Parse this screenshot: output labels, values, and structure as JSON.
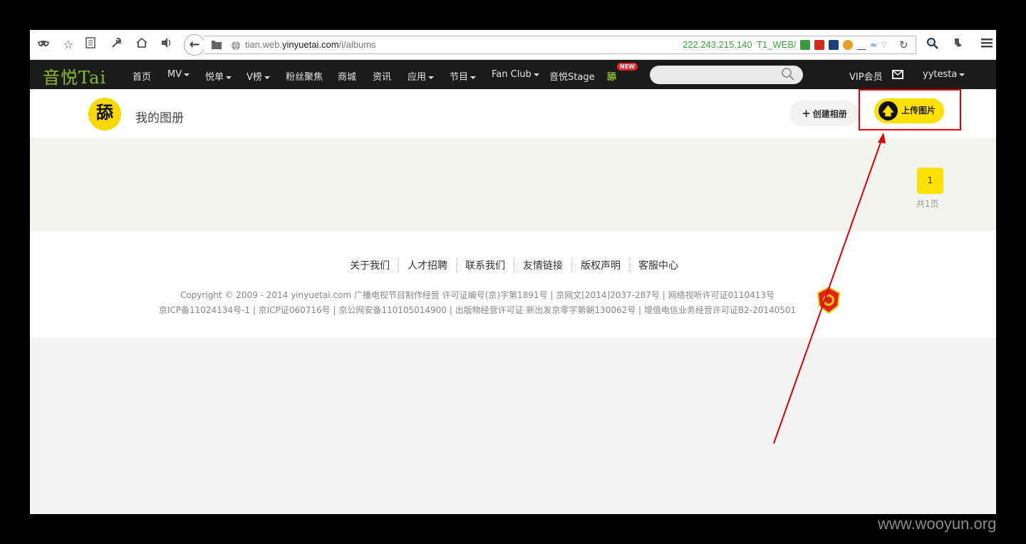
{
  "browser": {
    "url_prefix": "tian.web.",
    "url_domain": "yinyuetai.com",
    "url_path": "/i/albums",
    "ip": "222.243.215.140",
    "server": "T1_WEB/",
    "icons": [
      "mask-icon",
      "star-icon",
      "reader-icon",
      "wrench-icon",
      "home-icon",
      "speaker-icon",
      "back-icon",
      "globe-icon",
      "shield-icon",
      "flag-icon",
      "reload-icon",
      "search-icon",
      "ext-icon",
      "menu-icon"
    ]
  },
  "nav": {
    "logo": "音悦Tai",
    "items": [
      {
        "label": "首页",
        "dropdown": false
      },
      {
        "label": "MV",
        "dropdown": true
      },
      {
        "label": "悦单",
        "dropdown": true
      },
      {
        "label": "V榜",
        "dropdown": true
      },
      {
        "label": "粉丝聚焦",
        "dropdown": false
      },
      {
        "label": "商城",
        "dropdown": false
      },
      {
        "label": "资讯",
        "dropdown": false
      },
      {
        "label": "应用",
        "dropdown": true
      },
      {
        "label": "节目",
        "dropdown": true
      },
      {
        "label": "Fan Club",
        "dropdown": true
      },
      {
        "label": "音悦Stage",
        "dropdown": false
      }
    ],
    "special_label": "舔",
    "new_badge": "NEW",
    "vip": "VIP会员",
    "user": "yytesta"
  },
  "profile": {
    "avatar_text": "舔",
    "title": "我的图册",
    "create_album": "创建相册",
    "upload": "上传图片"
  },
  "pagination": {
    "current": "1",
    "total_label": "共1页"
  },
  "footer": {
    "links": [
      "关于我们",
      "人才招聘",
      "联系我们",
      "友情链接",
      "版权声明",
      "客服中心"
    ],
    "copyright_line1": "Copyright © 2009 - 2014 yinyuetai.com 广播电视节目制作经营 许可证编号(京)字第1891号 | 京网文[2014]2037-287号 | 网络视听许可证0110413号",
    "copyright_line2": "京ICP备11024134号-1 | 京ICP证060716号 | 京公网安备110105014900 | 出版物经营许可证 新出发京零字第朝130062号 | 增值电信业务经营许可证B2-20140501"
  },
  "watermark": "www.wooyun.org",
  "colors": {
    "accent_yellow": "#ffe100",
    "nav_bg": "#1b1b1b",
    "annotation_red": "#e00000",
    "ip_green": "#3aa53a"
  }
}
